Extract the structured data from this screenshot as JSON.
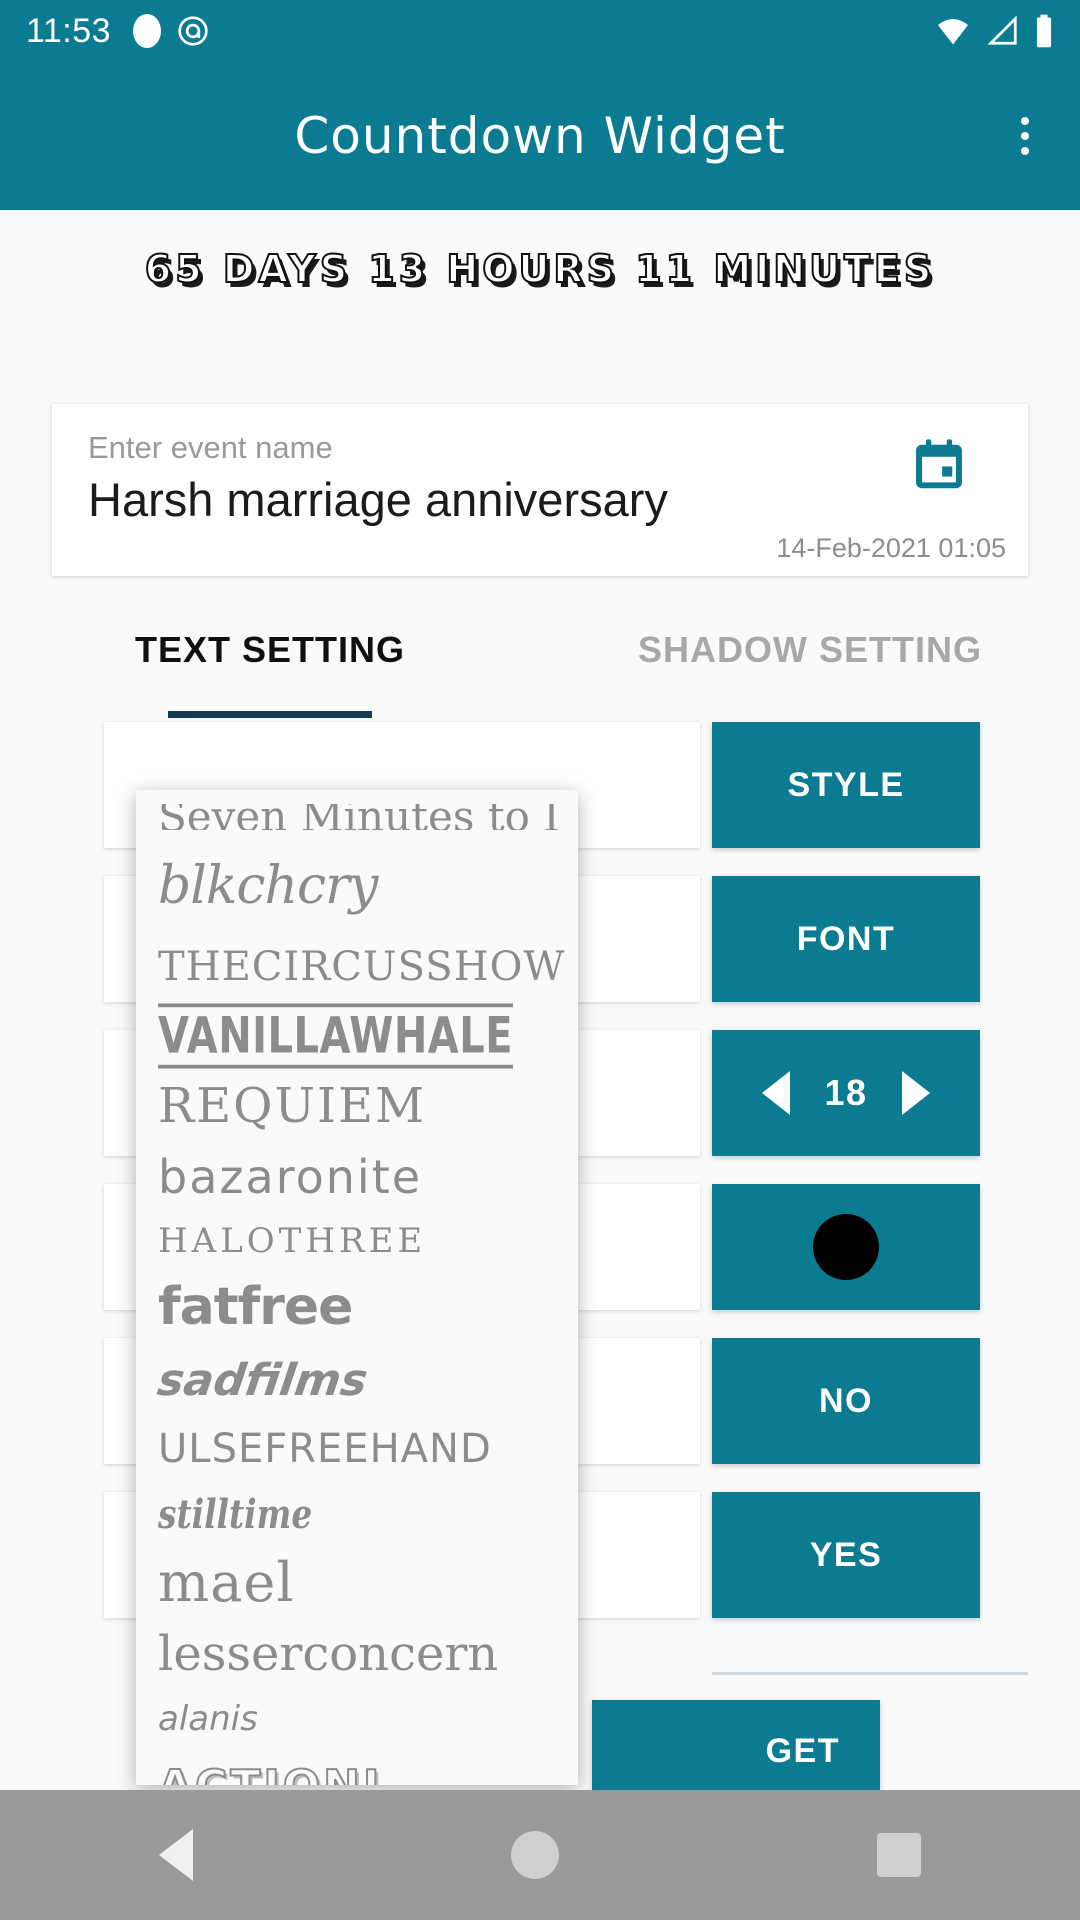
{
  "statusbar": {
    "time": "11:53",
    "icons": [
      "circle-indicator-icon",
      "screenshot-icon",
      "wifi-icon",
      "cellular-signal-icon",
      "battery-icon"
    ]
  },
  "appbar": {
    "title": "Countdown Widget",
    "overflow_label": "overflow-menu"
  },
  "countdown": {
    "text": "65 DAYS 13 HOURS 11 MINUTES",
    "days": 65,
    "hours": 13,
    "minutes": 11
  },
  "event_card": {
    "hint": "Enter event name",
    "name": "Harsh marriage anniversary",
    "date": "14-Feb-2021 01:05",
    "calendar_icon": "calendar-icon"
  },
  "tabs": [
    {
      "label": "TEXT SETTING",
      "active": true
    },
    {
      "label": "SHADOW SETTING",
      "active": false
    }
  ],
  "rows": [
    {
      "preview": "",
      "button": "STYLE",
      "kind": "text"
    },
    {
      "preview": "",
      "button": "FONT",
      "kind": "text"
    },
    {
      "preview": "",
      "button": "18",
      "kind": "stepper"
    },
    {
      "preview": "",
      "button": "",
      "kind": "color"
    },
    {
      "preview": "",
      "button": "NO",
      "kind": "text"
    },
    {
      "preview": "",
      "button": "YES",
      "kind": "text"
    }
  ],
  "stepper": {
    "value": "18",
    "left_icon": "triangle-left-icon",
    "right_icon": "triangle-right-icon"
  },
  "color": {
    "swatch_hex": "#000000"
  },
  "bottom": {
    "widget_button": "GET"
  },
  "dropdown": {
    "title": "font-picker",
    "items": [
      {
        "label": "Seven Minutes to I",
        "style": "f-partial"
      },
      {
        "label": "blkchcry",
        "style": "f-blkchcry"
      },
      {
        "label": "THECIRCUSSHOW",
        "style": "f-circus"
      },
      {
        "label": "VANILLAWHALE",
        "style": "f-vanilla"
      },
      {
        "label": "REQUIEM",
        "style": "f-requiem"
      },
      {
        "label": "bazaronite",
        "style": "f-bazaronite"
      },
      {
        "label": "HALOTHREE",
        "style": "f-halothree"
      },
      {
        "label": "fatfree",
        "style": "f-fatfree"
      },
      {
        "label": "sadfilms",
        "style": "f-sadfilms"
      },
      {
        "label": "ULSEFREEHAND",
        "style": "f-ulse"
      },
      {
        "label": "stilltime",
        "style": "f-stilltime"
      },
      {
        "label": "mael",
        "style": "f-mael"
      },
      {
        "label": "lesserconcern",
        "style": "f-lesser"
      },
      {
        "label": "alanis",
        "style": "f-alanis"
      },
      {
        "label": "ACTIONJ",
        "style": "f-actionj"
      }
    ]
  },
  "navbar": {
    "back": "back-triangle-icon",
    "home": "home-circle-icon",
    "recents": "recents-square-icon"
  },
  "colors": {
    "primary": "#0a7b91",
    "tab_indicator": "#123b55",
    "page_bg": "#fafafa",
    "navbar_bg": "#9a9a9a"
  }
}
